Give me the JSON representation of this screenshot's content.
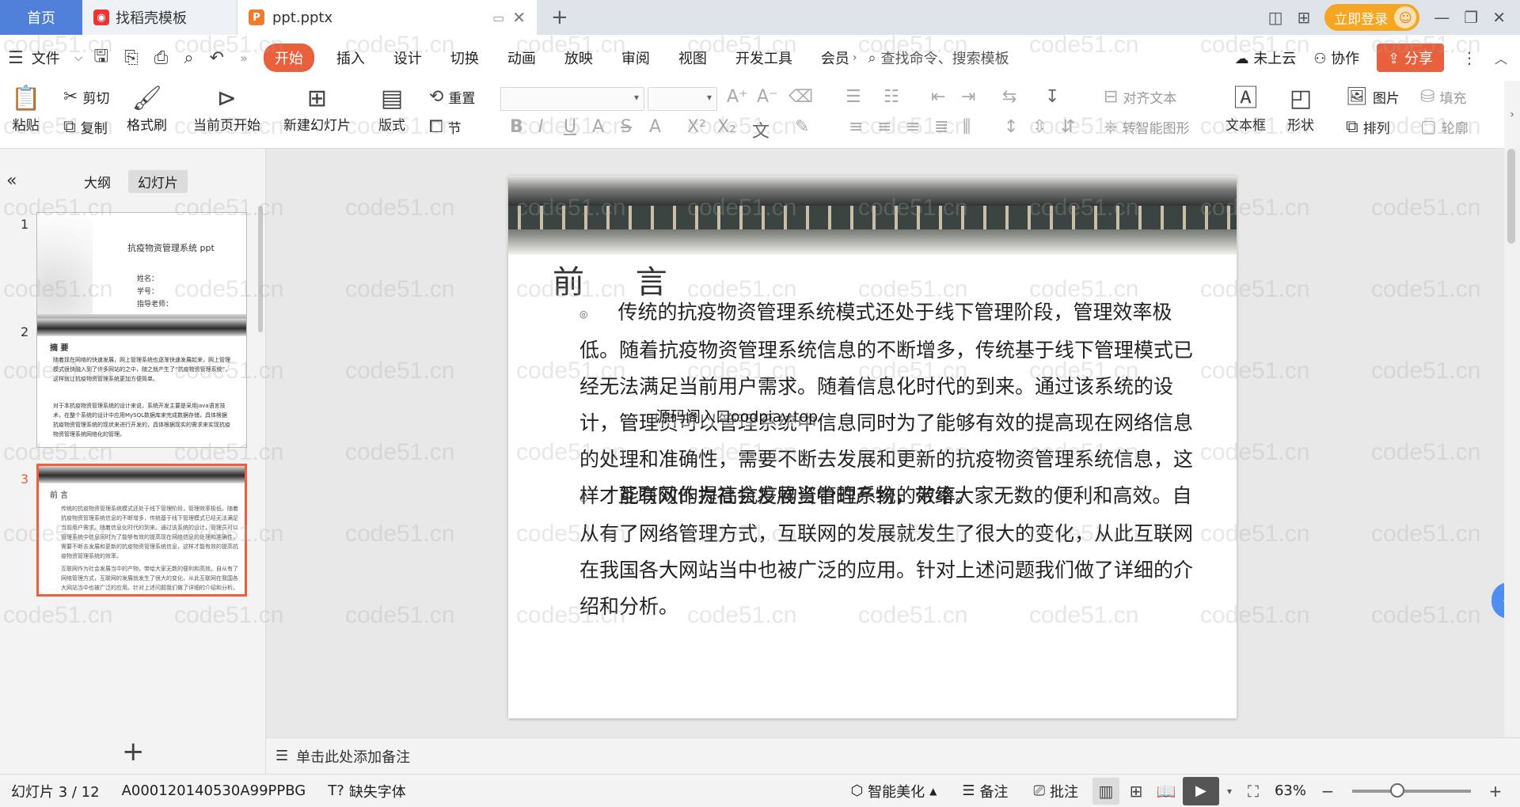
{
  "titlebar": {
    "home_tab": "首页",
    "template_tab": "找稻壳模板",
    "doc_tab": "ppt.pptx",
    "login": "立即登录"
  },
  "menu": {
    "file": "文件",
    "tabs": [
      "开始",
      "插入",
      "设计",
      "切换",
      "动画",
      "放映",
      "审阅",
      "视图",
      "开发工具",
      "会员"
    ],
    "search": "查找命令、搜索模板",
    "cloud": "未上云",
    "collab": "协作",
    "share": "分享"
  },
  "ribbon": {
    "paste": "粘贴",
    "cut": "剪切",
    "copy": "复制",
    "format_painter": "格式刷",
    "from_current": "当前页开始",
    "new_slide": "新建幻灯片",
    "layout": "版式",
    "section": "节",
    "reset": "重置",
    "align_text": "对齐文本",
    "smart_shape": "转智能图形",
    "textbox": "文本框",
    "shape": "形状",
    "arrange": "排列",
    "picture": "图片",
    "fill": "填充",
    "outline": "轮廓"
  },
  "left_panel": {
    "outline_tab": "大纲",
    "slides_tab": "幻灯片",
    "slide_numbers": [
      "1",
      "2",
      "3"
    ],
    "thumb1": {
      "title": "抗疫物资管理系统 ppt",
      "lines": [
        "姓名：",
        "学号：",
        "指导老师："
      ]
    },
    "thumb2": {
      "title": "摘  要",
      "p1": "随着现在网络的快速发展，网上管理系统也逐渐快速发展起来，网上管理模式很快融入到了许多网站的之中，随之就产生了“抗疫物资管理系统”，这样就让抗疫物资管理系统更加方便简单。",
      "p2": "对于本抗疫物资管理系统的设计来说，系统开发主要是采用java语言技术，在整个系统的设计中应用MySQL数据库来完成数据存储，具体根据抗疫物资管理系统的现状来进行开发的，具体根据现实的需求来实现抗疫物资管理系统网络化的管理。"
    },
    "thumb3": {
      "title": "前  言"
    }
  },
  "slide": {
    "title": "前  言",
    "para1": "传统的抗疫物资管理系统模式还处于线下管理阶段，管理效率极低。随着抗疫物资管理系统信息的不断增多，传统基于线下管理模式已经无法满足当前用户需求。随着信息化时代的到来。通过该系统的设计，管理员可以管理系统中信息同时为了能够有效的提高现在网络信息的处理和准确性，需要不断去发展和更新的抗疫物资管理系统信息，这样才能有效的提高抗疫物资管理系统的效率。",
    "para2": "互联网作为社会发展当中的产物，带给大家无数的便利和高效。自从有了网络管理方式，互联网的发展就发生了很大的变化，从此互联网在我国各大网站当中也被广泛的应用。针对上述问题我们做了详细的介绍和分析。",
    "overlay_watermark": "源码阁入口oodpiay.top"
  },
  "notes_placeholder": "单击此处添加备注",
  "status": {
    "slide_counter": "幻灯片 3 / 12",
    "doc_code": "A000120140530A99PPBG",
    "missing_font": "缺失字体",
    "beautify": "智能美化",
    "notes": "备注",
    "comments": "批注",
    "zoom": "63%"
  },
  "watermark_text": "code51.cn",
  "colors": {
    "accent": "#e8603c",
    "home_tab": "#4f7fd8",
    "login": "#f5a623"
  }
}
